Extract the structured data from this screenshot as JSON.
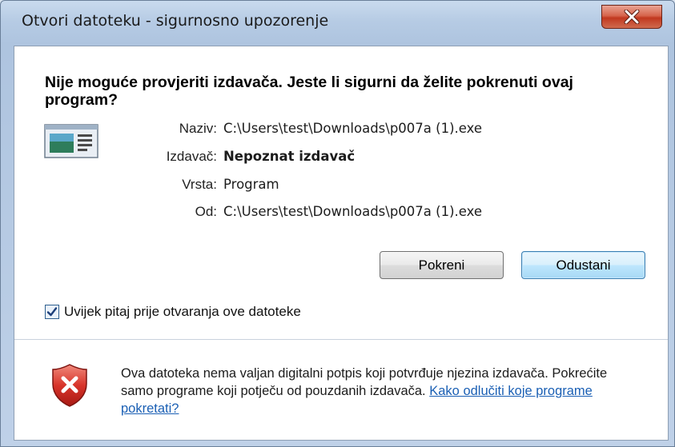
{
  "window": {
    "title": "Otvori datoteku - sigurnosno upozorenje",
    "close_icon": "close-icon"
  },
  "dialog": {
    "heading": "Nije moguće provjeriti izdavača. Jeste li sigurni da želite pokrenuti ovaj program?",
    "app_icon": "program-window-icon",
    "fields": [
      {
        "label": "Naziv:",
        "value": "C:\\Users\\test\\Downloads\\p007a (1).exe"
      },
      {
        "label": "Izdavač:",
        "value": "Nepoznat izdavač"
      },
      {
        "label": "Vrsta:",
        "value": "Program"
      },
      {
        "label": "Od:",
        "value": "C:\\Users\\test\\Downloads\\p007a (1).exe"
      }
    ],
    "buttons": {
      "run": "Pokreni",
      "cancel": "Odustani"
    },
    "checkbox": {
      "label": "Uvijek pitaj prije otvaranja ove datoteke",
      "checked": true
    },
    "warning": {
      "icon": "shield-error-icon",
      "text": "Ova datoteka nema valjan digitalni potpis koji potvrđuje njezina izdavača. Pokrećite samo programe koji potječu od pouzdanih izdavača.",
      "link": "Kako odlučiti koje programe pokretati?"
    }
  },
  "colors": {
    "link": "#1a5fb4",
    "close_button": "#c1381f",
    "default_button_border": "#3c7fb1",
    "shield": "#c8241c"
  }
}
